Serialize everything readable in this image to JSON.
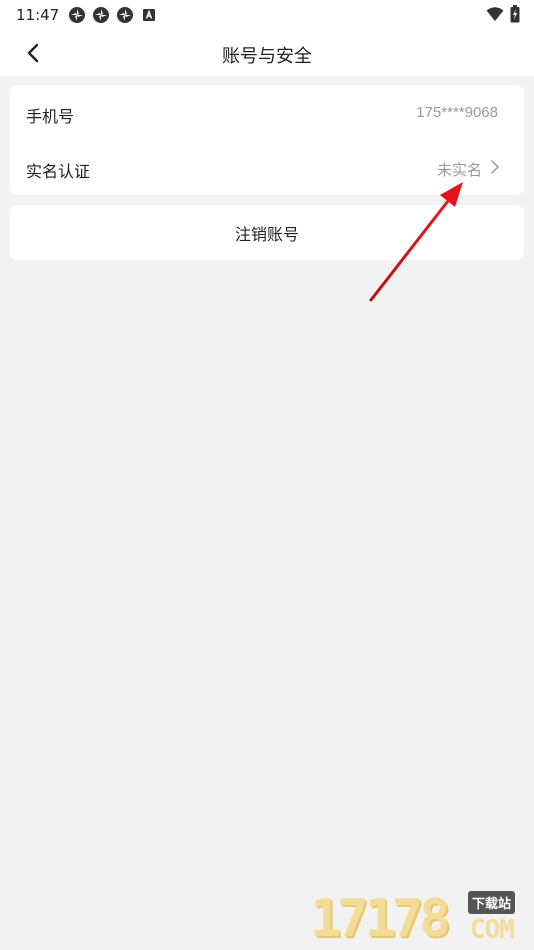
{
  "status_bar": {
    "time": "11:47",
    "left_icons": [
      "app-notification-icon",
      "app-notification-icon",
      "app-notification-icon",
      "keyboard-a-icon"
    ],
    "right_icons": [
      "wifi-icon",
      "battery-charging-icon"
    ]
  },
  "header": {
    "title": "账号与安全",
    "back_icon": "chevron-left-icon"
  },
  "account_info": {
    "phone": {
      "label": "手机号",
      "value": "175****9068"
    },
    "real_name": {
      "label": "实名认证",
      "value": "未实名",
      "chevron_icon": "chevron-right-icon"
    }
  },
  "logout": {
    "label": "注销账号"
  },
  "annotation": {
    "type": "red-arrow",
    "color": "#e0161b",
    "points_to": "real-name-status"
  },
  "watermark": {
    "digits": "17178",
    "tag": "下载站",
    "com": "COM"
  },
  "colors": {
    "background": "#f2f2f2",
    "card": "#ffffff",
    "text_primary": "#222222",
    "text_secondary": "#9a9a9a"
  }
}
